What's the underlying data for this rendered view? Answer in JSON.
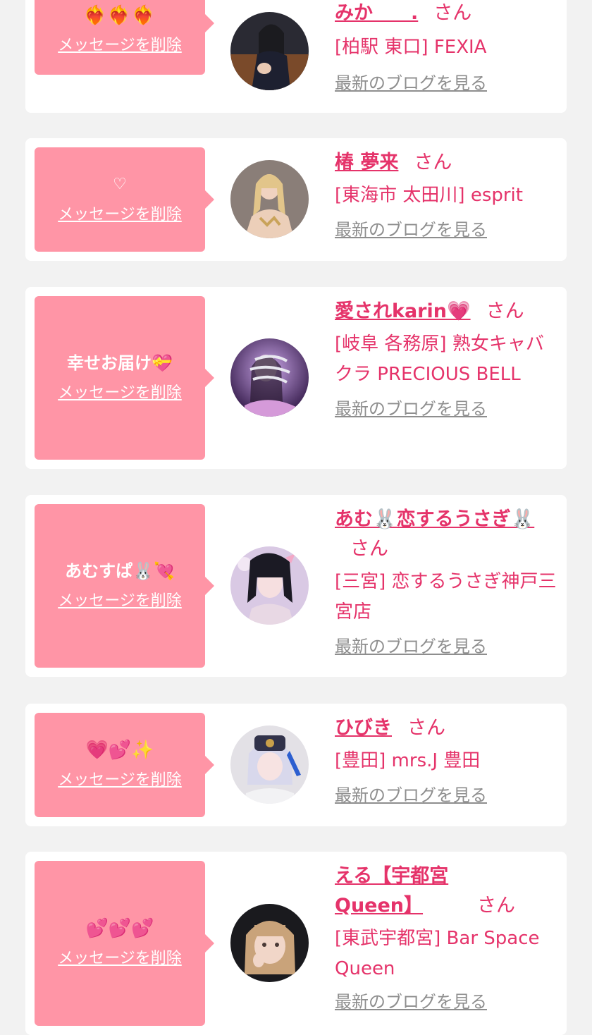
{
  "delete_label": "メッセージを削除",
  "honorific": "さん",
  "blog_label": "最新のブログを見る",
  "colors": {
    "accent": "#e5336a",
    "bubble": "#ff95a6",
    "card": "#ffffff",
    "page": "#f2f2f2",
    "link_gray": "#8e8e8e"
  },
  "items": [
    {
      "message": "❤️‍🔥❤️‍🔥❤️‍🔥",
      "name": "みか　　.",
      "shop": "[柏駅 東口] FEXIA"
    },
    {
      "message": "♡",
      "name": "椿 夢来",
      "shop": "[東海市 太田川] esprit"
    },
    {
      "message": "幸せお届け💝",
      "name": "愛されkarin💗",
      "shop": "[岐阜 各務原]  熟女キャバクラ PRECIOUS BELL"
    },
    {
      "message": "あむすぱ🐰💘",
      "name": "あむ🐰恋するうさぎ🐰",
      "shop": "[三宮] 恋するうさぎ神戸三宮店"
    },
    {
      "message": "💗💕✨",
      "name": "ひびき",
      "shop": "[豊田] mrs.J 豊田"
    },
    {
      "message": "💕💕💕",
      "name": "える【宇都宮Queen】",
      "shop": "[東武宇都宮] Bar Space Queen"
    }
  ]
}
